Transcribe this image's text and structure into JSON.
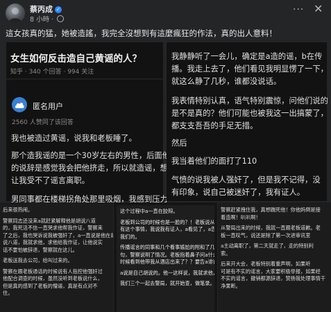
{
  "post": {
    "author": "蔡丙成",
    "verified_mark": "✓",
    "time": "8 小時",
    "visibility_icon": "globe-icon",
    "more_label": "···",
    "close_label": "✕",
    "caption": "這女孩真的猛，她被造謠，我完全沒想到有這麼瘋狂的作法，真的出人意料！"
  },
  "question": {
    "title": "女生如何反击造自己黄谣的人？",
    "meta": "知乎 · 340 个回答 · 994 关注"
  },
  "answer": {
    "avatar_icon": "cloud-icon",
    "author": "匿名用户",
    "likes": "2560 人赞同了该回答",
    "left_lines": [
      "我也被造过黄谣，说我和老板睡了。",
      "",
      "那个造我谣的是一个30岁左右的男性，后面他",
      "的说辞是感觉我会把他挤走，所以就造谣，想",
      "让我受不了谣言离职。",
      "",
      "男同事都在楼梯拐角处那里吸烟，我感到压力"
    ],
    "right_lines": [
      "我静静听了一会儿，确定是a造的谣，b在传",
      "播。我走上去了，他们看见我明显愣了一下，",
      "就这么静了几秒，谁都没说话。",
      "",
      "我表情特别认真，语气特别震惊，问他们说的",
      "是不是真的？他们可能也被我这一出搞蒙了，",
      "都支支吾吾的手足无措。",
      "",
      "然后",
      "",
      "我当着他们的面打了110",
      "",
      "气愤的说我被人强奸了，但是我不记得，没",
      "有印象，说自己被迷奸了，我有证人。"
    ]
  },
  "more_screenshots": {
    "col1": [
      "后来很热闹。",
      "",
      "警察同志还没来a就赶紧解释他是胡说八道",
      "的，我死活不信一直哭求他帮我作证，警察来",
      "了之后，我也哭诉说我被强奸了，a一直说是他在胡",
      "说八道，我就求他，求他给我作证，让他说实",
      "话不要怕被辞退，警察就在这儿。",
      "",
      "老板送我去公司，给叫过来的。",
      "",
      "警察在跟老板通话的时候说有人指控他强奸过",
      "他配合调查的时候，虽然没听到老板说什么，",
      "但是真的感到了老板的懵逼，真是有点对不",
      "住。"
    ],
    "col2": [
      "这个过程中a一直在狡辩。",
      "",
      "老板到公司的时候也是一脸的？！老板说从来没",
      "有这个事情，我说我有证人，a看见了，a告诉",
      "我们的。",
      "",
      "传播谣言的同事和几个看事尴尬的附和了几",
      "句，警察说明了情况。老板指着鼻子问a什么",
      "时候看到他带我从酒店出来了？？要告a诽谤",
      "",
      "a说是自己胡说的。他一这样说，我就求他，",
      "",
      "我们三个一起去警局，就开始查，做笔录。"
    ],
    "col3": [
      "警察赶紧拽住我，真想踹死他！你他妈倒是接",
      "着造啊！叭叭啊！",
      "",
      "从警局出来的时候，我就一直跟老板道歉。老",
      "板一直叹气，说还是除了第一次进审讯室",
      "",
      "a主动离职了，第二天就走了，走的特别利",
      "索。",
      "",
      "后来开大会，老板特别着重声明，如果听",
      "可是有不实的谣言，大家要积极举报，如果经",
      "不实的谣言，撤销都源辞退，赞扬我处理事情干",
      "净果断。"
    ]
  }
}
